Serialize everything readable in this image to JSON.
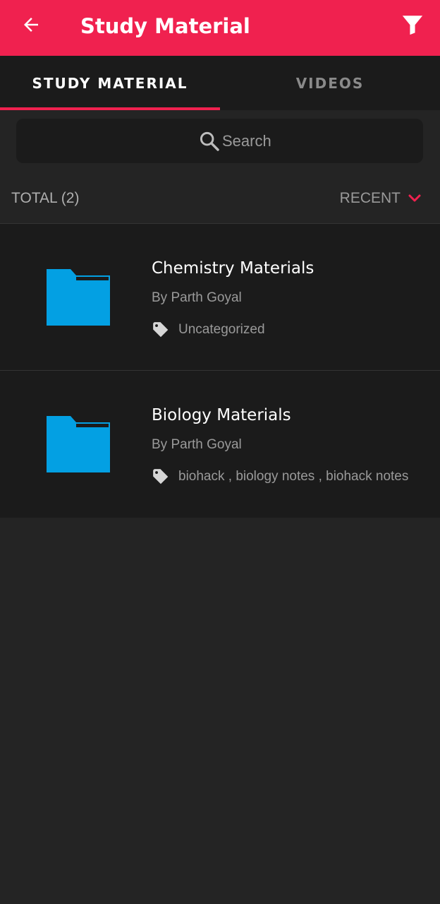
{
  "app_bar": {
    "title": "Study Material",
    "back_icon": "arrow-left-icon",
    "filter_icon": "filter-icon",
    "color": "#F0214F"
  },
  "tabs": [
    {
      "label": "STUDY MATERIAL",
      "active": true
    },
    {
      "label": "VIDEOS",
      "active": false
    }
  ],
  "search": {
    "placeholder": "Search",
    "value": "",
    "icon": "search-icon"
  },
  "summary": {
    "total_label": "TOTAL (2)",
    "sort_label": "RECENT",
    "sort_icon": "chevron-down-icon"
  },
  "items": [
    {
      "title": "Chemistry Materials",
      "author": "By Parth Goyal",
      "tags": "Uncategorized",
      "icon": "folder-icon"
    },
    {
      "title": "Biology Materials",
      "author": "By Parth Goyal",
      "tags": "biohack , biology notes , biohack notes",
      "icon": "folder-icon"
    }
  ],
  "colors": {
    "accent": "#F0214F",
    "folder": "#03A0E3",
    "background": "#242424",
    "surface": "#1B1B1B"
  }
}
